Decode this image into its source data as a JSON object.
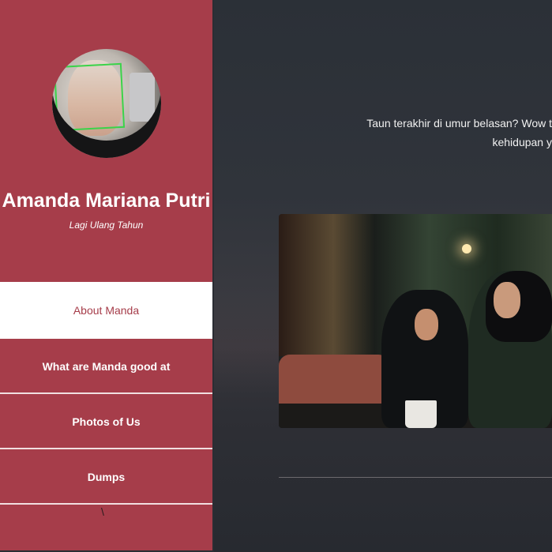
{
  "sidebar": {
    "avatar_icon": "profile-photo",
    "name": "Amanda Mariana Putri",
    "subtitle": "Lagi Ulang Tahun",
    "items": [
      {
        "label": "About Manda",
        "active": true
      },
      {
        "label": "What are Manda good at",
        "active": false
      },
      {
        "label": "Photos of Us",
        "active": false
      },
      {
        "label": "Dumps",
        "active": false
      }
    ],
    "stray_char": "\\"
  },
  "main": {
    "intro_line1": "Taun terakhir di umur belasan? Wow t",
    "intro_line2": "kehidupan y"
  },
  "colors": {
    "accent": "#a63d4a",
    "background": "#2b2d33",
    "text": "#ffffff"
  }
}
